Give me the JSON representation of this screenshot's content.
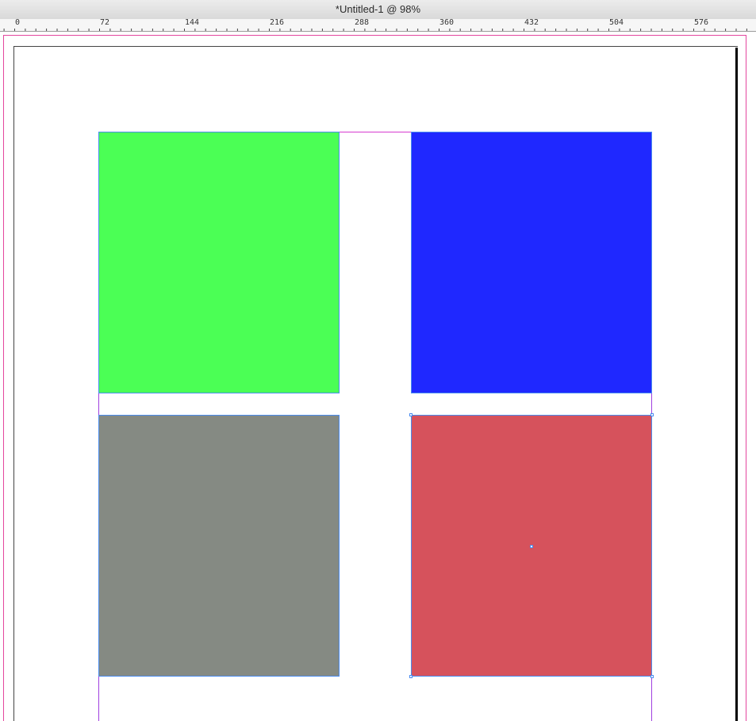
{
  "window": {
    "title": "*Untitled-1 @ 98%"
  },
  "ruler": {
    "labels": [
      "0",
      "72",
      "144",
      "216",
      "288",
      "360",
      "432",
      "504",
      "576"
    ]
  },
  "frames": [
    {
      "name": "green-rectangle-frame",
      "fill": "#4bff55"
    },
    {
      "name": "blue-rectangle-frame",
      "fill": "#1f28ff"
    },
    {
      "name": "gray-rectangle-frame",
      "fill": "#858a83"
    },
    {
      "name": "red-rectangle-frame",
      "fill": "#d6525c",
      "selected": true
    }
  ],
  "colors": {
    "selection": "#4a8cf0",
    "margin_guide": "#a040e0",
    "bleed_guide": "#e4469e"
  }
}
